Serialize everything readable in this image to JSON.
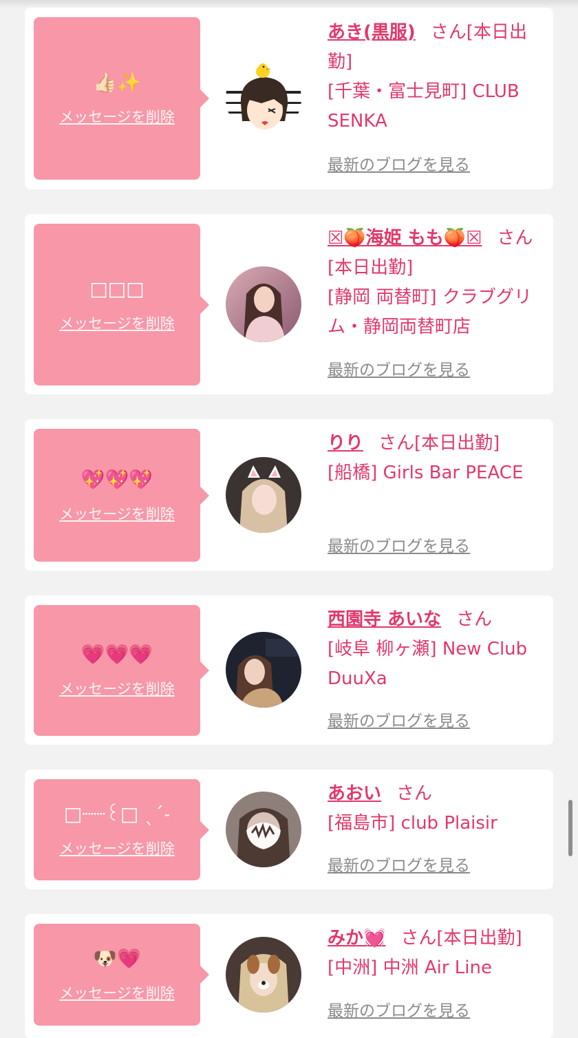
{
  "delete_label": "メッセージを削除",
  "blog_label": "最新のブログを見る",
  "honorific": "さん",
  "accent_color": "#e2386a",
  "bubble_color": "#f797a7",
  "items": [
    {
      "bubble_text": "👍🏻✨",
      "name": "あき(黒服)",
      "status": "[本日出勤]",
      "shop": "[千葉・富士見町] CLUB SENKA",
      "avatar_icon": "cartoon-avatar-icon"
    },
    {
      "bubble_text": "□□□",
      "name": "☒🍑海姫 もも🍑☒",
      "status": "[本日出勤]",
      "shop": "[静岡 両替町] クラブグリム・静岡両替町店",
      "avatar_icon": "profile-photo-icon"
    },
    {
      "bubble_text": "💖💖💖",
      "name": "りり",
      "status": "[本日出勤]",
      "shop": "[船橋] Girls Bar PEACE",
      "avatar_icon": "profile-photo-icon"
    },
    {
      "bubble_text": "💗💗💗",
      "name": "西園寺 あいな",
      "status": "",
      "shop": "[岐阜 柳ヶ瀬] New Club DuuXa",
      "avatar_icon": "profile-photo-icon"
    },
    {
      "bubble_text": "□┈┈꒰□ ˎˊ˗",
      "name": "あおい",
      "status": "",
      "shop": "[福島市] club Plaisir",
      "avatar_icon": "profile-photo-icon"
    },
    {
      "bubble_text": "🐶💗",
      "name": "みか💓",
      "status": "[本日出勤]",
      "shop": "[中洲] 中洲 Air Line",
      "avatar_icon": "profile-photo-icon"
    }
  ]
}
